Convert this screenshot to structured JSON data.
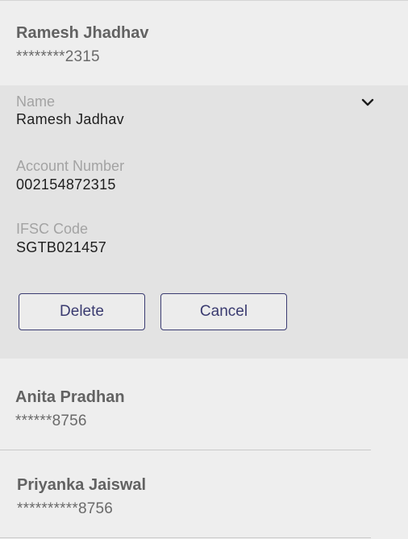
{
  "payees": [
    {
      "name": "Ramesh Jhadhav",
      "masked_account": "********2315"
    },
    {
      "name": "Anita Pradhan",
      "masked_account": "******8756"
    },
    {
      "name": "Priyanka Jaiswal",
      "masked_account": "**********8756"
    }
  ],
  "details": {
    "name_label": "Name",
    "name_value": "Ramesh Jadhav",
    "account_label": "Account Number",
    "account_value": "002154872315",
    "ifsc_label": "IFSC Code",
    "ifsc_value": "SGTB021457",
    "collapse_icon": "chevron-down-icon"
  },
  "actions": {
    "delete_label": "Delete",
    "cancel_label": "Cancel"
  },
  "colors": {
    "background": "#eeeeee",
    "expanded_background": "#e3e3e3",
    "button_border": "#3b3c72",
    "button_text": "#3a3b70"
  }
}
